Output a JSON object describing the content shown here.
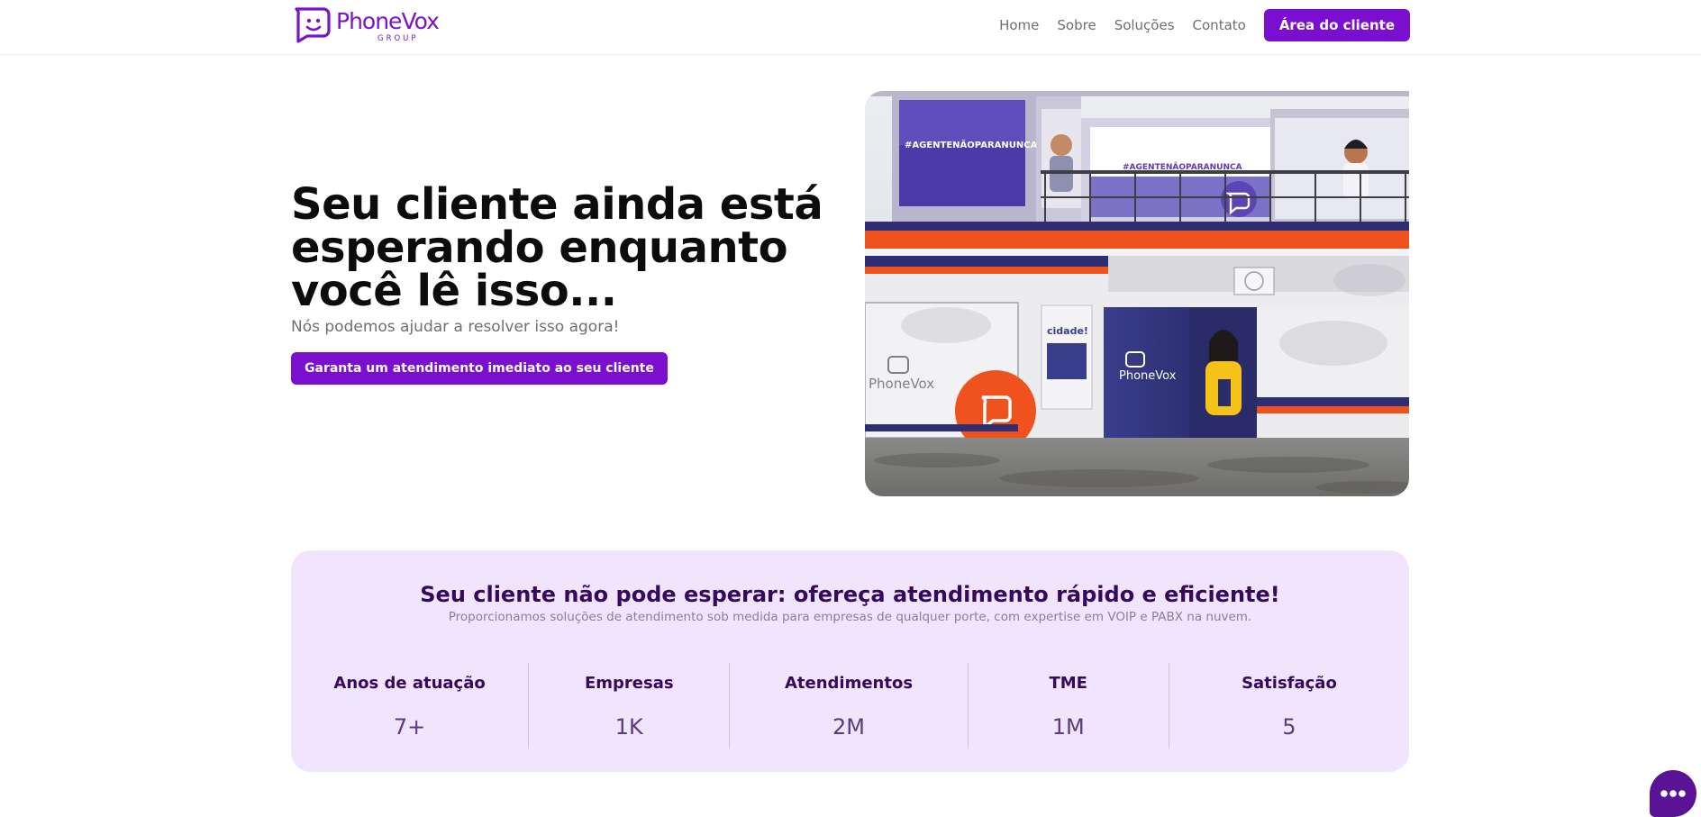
{
  "header": {
    "logo": {
      "name": "PhoneVox",
      "subtitle": "GROUP",
      "icon": "phonevox-chat-face-logo-icon"
    },
    "nav": [
      {
        "label": "Home"
      },
      {
        "label": "Sobre"
      },
      {
        "label": "Soluções"
      },
      {
        "label": "Contato"
      }
    ],
    "cta_label": "Área do cliente"
  },
  "hero": {
    "title": "Seu cliente ainda está esperando enquanto você lê isso...",
    "subtitle": "Nós podemos ajudar a resolver isso agora!",
    "cta_label": "Garanta um atendimento imediato ao seu cliente",
    "image": {
      "subject": "storefront-photo",
      "signage": [
        "#AGENTENÃOPARANUNCA",
        "#AGENTENÃOPARANUNCA",
        "cidade!",
        "PhoneVox",
        "PhoneVox"
      ]
    }
  },
  "stats": {
    "title": "Seu cliente não pode esperar: ofereça atendimento rápido e eficiente!",
    "subtitle": "Proporcionamos soluções de atendimento sob medida para empresas de qualquer porte, com expertise em VOIP e PABX na nuvem.",
    "items": [
      {
        "label": "Anos de atuação",
        "value": "7+"
      },
      {
        "label": "Empresas",
        "value": "1K"
      },
      {
        "label": "Atendimentos",
        "value": "2M"
      },
      {
        "label": "TME",
        "value": "1M"
      },
      {
        "label": "Satisfação",
        "value": "5"
      }
    ]
  },
  "chat": {
    "icon": "chat-dots-icon"
  },
  "colors": {
    "brand": "#7b0fd0",
    "brand_dark": "#35095e",
    "stats_background": "#f0e5fd",
    "chat_button": "#5b1395",
    "storefront_orange": "#f0521d",
    "storefront_navy": "#2b2d6e"
  }
}
